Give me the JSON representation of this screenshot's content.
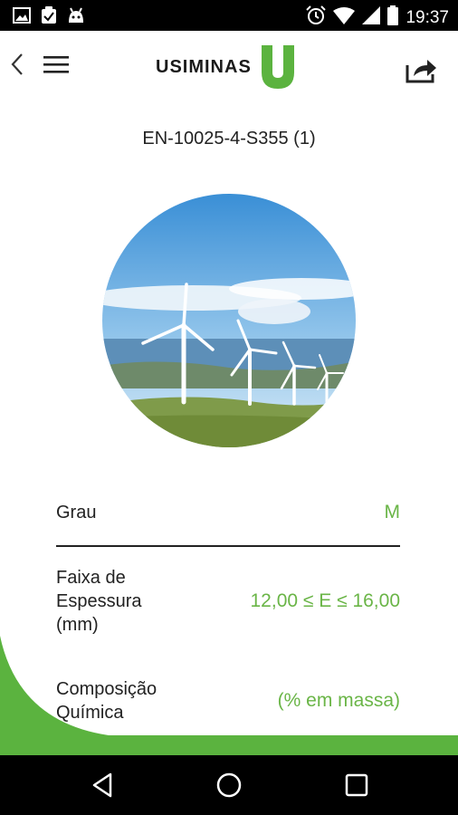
{
  "status_bar": {
    "time": "19:37",
    "left_icons": [
      "image-icon",
      "clipboard-check-icon",
      "android-icon"
    ],
    "right_icons": [
      "alarm-icon",
      "wifi-icon",
      "signal-icon",
      "battery-icon"
    ]
  },
  "header": {
    "brand": "USIMINAS",
    "back_icon": "chevron-left-icon",
    "menu_icon": "hamburger-icon",
    "share_icon": "share-icon"
  },
  "product": {
    "title": "EN-10025-4-S355 (1)"
  },
  "specs": [
    {
      "label": "Grau",
      "value": "M"
    },
    {
      "label": "Faixa de Espessura (mm)",
      "value": "12,00 ≤ E ≤ 16,00"
    },
    {
      "label": "Composição Química",
      "value": "(% em massa)"
    }
  ],
  "colors": {
    "accent_green": "#6ab547",
    "brand_green": "#5bb33f",
    "status_bar": "#000000"
  },
  "nav_bar": [
    "back-triangle-icon",
    "home-circle-icon",
    "recents-square-icon"
  ]
}
